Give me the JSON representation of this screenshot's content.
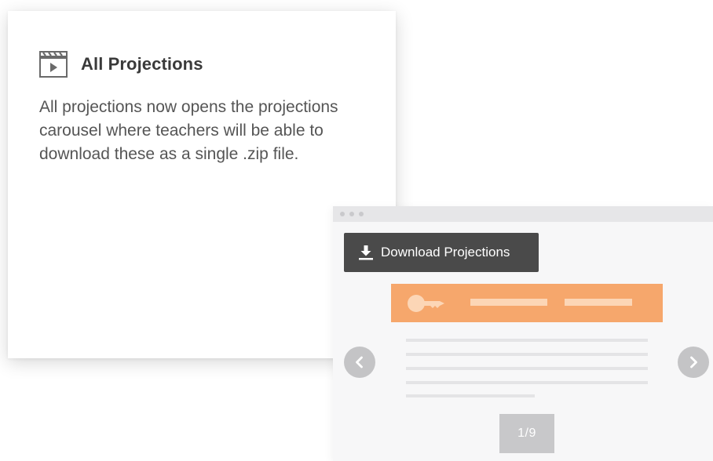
{
  "card": {
    "icon": "film-clapper-icon",
    "title": "All Projections",
    "description": "All projections now opens the projections carousel where teachers will be able to download these as a single .zip file."
  },
  "browser": {
    "download_button": {
      "icon": "download-icon",
      "label": "Download Projections"
    },
    "slide": {
      "icon": "key-icon",
      "banner_color": "#f6a76c"
    },
    "carousel": {
      "prev_icon": "chevron-left-icon",
      "next_icon": "chevron-right-icon",
      "page_indicator": "1/9"
    }
  },
  "colors": {
    "accent": "#f6a76c",
    "button_dark": "#4a4a4a",
    "title_text": "#3a3a3a",
    "body_text": "#555555"
  }
}
